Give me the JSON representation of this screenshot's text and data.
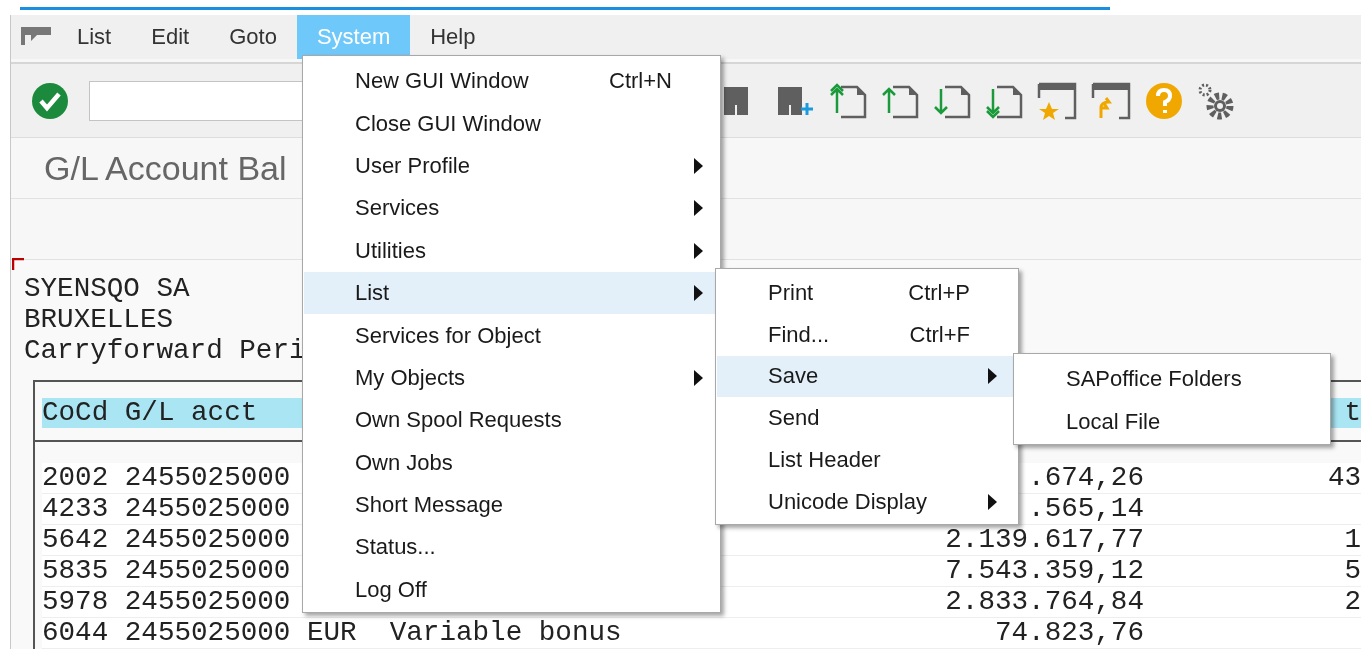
{
  "menu_bar": [
    {
      "label": "List",
      "selected": false
    },
    {
      "label": "Edit",
      "selected": false
    },
    {
      "label": "Goto",
      "selected": false
    },
    {
      "label": "System",
      "selected": true
    },
    {
      "label": "Help",
      "selected": false
    }
  ],
  "title": "G/L Account Bal",
  "report": {
    "header_lines": [
      "SYENSQO SA",
      "BRUXELLES",
      "Carryforward Peri"
    ],
    "columns": [
      "CoCd G/L acct",
      "t"
    ],
    "rows": [
      {
        "column_1": "2002 2455025000",
        "amount": ".674,26",
        "column_3": "43"
      },
      {
        "column_1": "4233 2455025000",
        "amount": ".565,14"
      },
      {
        "column_1": "5642 2455025000",
        "amount": "2.139.617,77",
        "column_3": "1"
      },
      {
        "column_1": "5835 2455025000",
        "amount": "7.543.359,12",
        "column_3": "5"
      },
      {
        "column_1": "5978 2455025000",
        "amount": "2.833.764,84",
        "column_3": "2"
      },
      {
        "column_1": "6044 2455025000 EUR  Variable bonus",
        "amount": "74.823,76"
      }
    ]
  },
  "system_menu": {
    "items": [
      {
        "label": "New GUI Window",
        "shortcut": "Ctrl+N",
        "submenu": false,
        "selected": false
      },
      {
        "label": "Close GUI Window",
        "submenu": false,
        "selected": false
      },
      {
        "label": "User Profile",
        "submenu": true,
        "selected": false
      },
      {
        "label": "Services",
        "submenu": true,
        "selected": false
      },
      {
        "label": "Utilities",
        "submenu": true,
        "selected": false
      },
      {
        "label": "List",
        "submenu": true,
        "selected": true
      },
      {
        "label": "Services for Object",
        "submenu": false,
        "selected": false
      },
      {
        "label": "My Objects",
        "submenu": true,
        "selected": false
      },
      {
        "label": "Own Spool Requests",
        "submenu": false,
        "selected": false
      },
      {
        "label": "Own Jobs",
        "submenu": false,
        "selected": false
      },
      {
        "label": "Short Message",
        "submenu": false,
        "selected": false
      },
      {
        "label": "Status...",
        "submenu": false,
        "selected": false
      },
      {
        "label": "Log Off",
        "submenu": false,
        "selected": false
      }
    ]
  },
  "list_menu": {
    "items": [
      {
        "label": "Print",
        "shortcut": "Ctrl+P",
        "submenu": false,
        "selected": false
      },
      {
        "label": "Find...",
        "shortcut": "Ctrl+F",
        "submenu": false,
        "selected": false
      },
      {
        "label": "Save",
        "submenu": true,
        "selected": true
      },
      {
        "label": "Send",
        "submenu": false,
        "selected": false
      },
      {
        "label": "List Header",
        "submenu": false,
        "selected": false
      },
      {
        "label": "Unicode Display",
        "submenu": true,
        "selected": false
      }
    ]
  },
  "save_menu": {
    "items": [
      {
        "label": "SAPoffice Folders",
        "submenu": false,
        "selected": false
      },
      {
        "label": "Local File",
        "submenu": false,
        "selected": false
      }
    ]
  }
}
